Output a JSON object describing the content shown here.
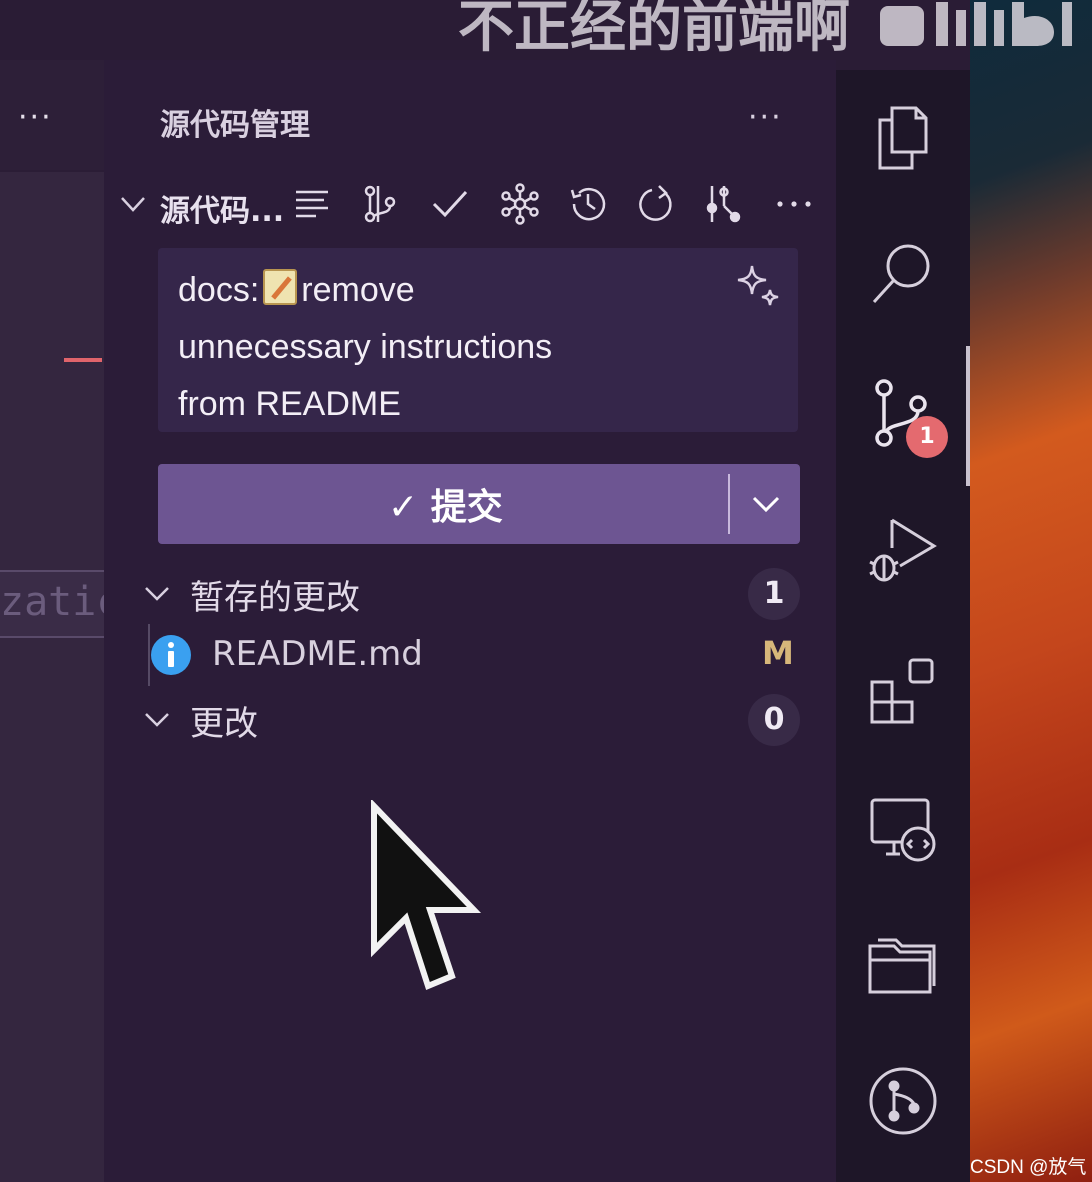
{
  "watermark": {
    "text": "不正经的前端啊",
    "logo": "bilibili-logo"
  },
  "editor": {
    "more_label": "···",
    "code_fragment": "zatic"
  },
  "source_control": {
    "title": "源代码管理",
    "more_label": "···",
    "repo": {
      "name": "源代码...",
      "toolbar_icons": [
        "list-view-icon",
        "branch-compare-icon",
        "check-icon",
        "graph-icon",
        "history-icon",
        "refresh-icon",
        "git-fetch-icon",
        "more-icon"
      ]
    },
    "commit_message": {
      "line1_prefix": "docs:",
      "emoji": "memo-emoji",
      "line1_suffix": "remove",
      "line2": "unnecessary instructions",
      "line3": "from README"
    },
    "commit_button": {
      "check": "✓",
      "label": "提交"
    },
    "sections": [
      {
        "label": "暂存的更改",
        "count": "1"
      },
      {
        "label": "更改",
        "count": "0"
      }
    ],
    "staged_files": [
      {
        "name": "README.md",
        "status": "M",
        "icon": "info-icon"
      }
    ]
  },
  "activity_bar": {
    "icons": [
      "explorer-icon",
      "search-icon",
      "source-control-icon",
      "run-debug-icon",
      "extensions-icon",
      "remote-explorer-icon",
      "folder-icon",
      "git-graph-icon"
    ],
    "source_control_badge": "1"
  },
  "footer": {
    "credit": "CSDN @放气"
  },
  "colors": {
    "panel_bg": "#2b1c38",
    "commit_button": "#6d5592",
    "badge": "#e46a6f",
    "modified": "#d7b77a",
    "info": "#3aa0f0"
  }
}
